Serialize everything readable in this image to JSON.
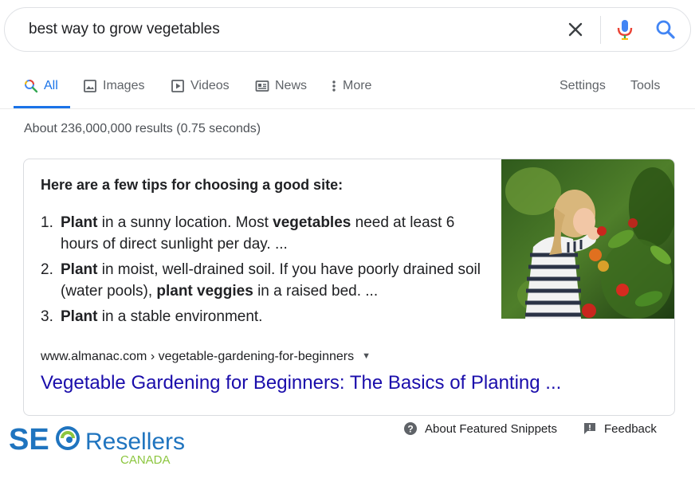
{
  "search": {
    "query": "best way to grow vegetables"
  },
  "tabs": [
    {
      "label": "All",
      "icon": "search-icon",
      "active": true
    },
    {
      "label": "Images",
      "icon": "image-icon"
    },
    {
      "label": "Videos",
      "icon": "play-icon"
    },
    {
      "label": "News",
      "icon": "news-icon"
    },
    {
      "label": "More",
      "icon": "more-vert-icon"
    },
    {
      "label": "Settings"
    },
    {
      "label": "Tools"
    }
  ],
  "stats": "About 236,000,000 results (0.75 seconds)",
  "snippet": {
    "heading": "Here are a few tips for choosing a good site:",
    "items": [
      {
        "num": "1.",
        "parts": [
          [
            "b",
            "Plant"
          ],
          [
            "t",
            " in a sunny location. Most "
          ],
          [
            "b",
            "vegetables"
          ],
          [
            "t",
            " need at least 6 hours of direct sunlight per day. ..."
          ]
        ]
      },
      {
        "num": "2.",
        "parts": [
          [
            "b",
            "Plant"
          ],
          [
            "t",
            " in moist, well-drained soil. If you have poorly drained soil (water pools), "
          ],
          [
            "b",
            "plant veggies"
          ],
          [
            "t",
            " in a raised bed. ..."
          ]
        ]
      },
      {
        "num": "3.",
        "parts": [
          [
            "b",
            "Plant"
          ],
          [
            "t",
            " in a stable environment."
          ]
        ]
      }
    ],
    "image_icon": "girl-eating-tomatoes-photo",
    "breadcrumb": "www.almanac.com › vegetable-gardening-for-beginners",
    "title": "Vegetable Gardening for Beginners: The Basics of Planting ..."
  },
  "footer": {
    "about": "About Featured Snippets",
    "feedback": "Feedback"
  },
  "logo": {
    "seo": "SEO",
    "resellers": "Resellers",
    "canada": "CANADA"
  },
  "colors": {
    "link": "#1a0dab",
    "accent": "#1a73e8",
    "logo_blue": "#1f74bf",
    "logo_green": "#8cc63f"
  }
}
